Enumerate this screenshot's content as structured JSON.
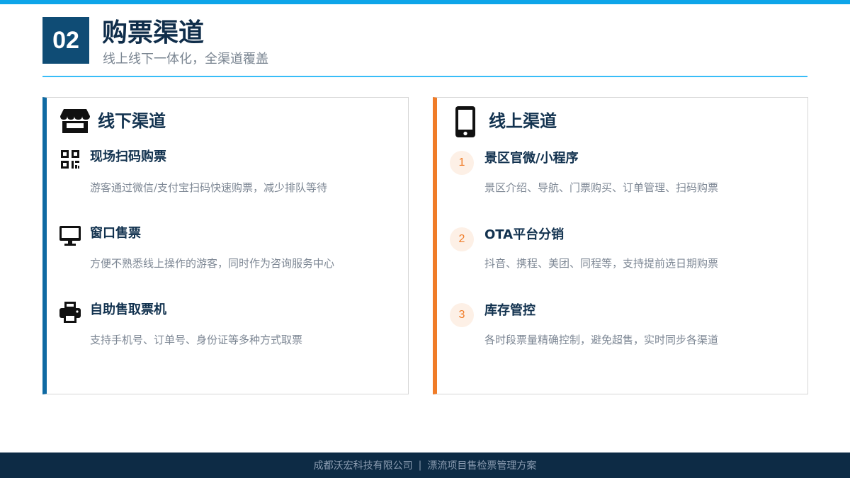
{
  "header": {
    "section_number": "02",
    "title": "购票渠道",
    "subtitle": "线上线下一体化，全渠道覆盖"
  },
  "offline": {
    "title": "线下渠道",
    "icon": "store-icon",
    "items": [
      {
        "icon": "qr-code-icon",
        "title": "现场扫码购票",
        "desc": "游客通过微信/支付宝扫码快速购票，减少排队等待"
      },
      {
        "icon": "monitor-icon",
        "title": "窗口售票",
        "desc": "方便不熟悉线上操作的游客，同时作为咨询服务中心"
      },
      {
        "icon": "printer-icon",
        "title": "自助售取票机",
        "desc": "支持手机号、订单号、身份证等多种方式取票"
      }
    ]
  },
  "online": {
    "title": "线上渠道",
    "icon": "mobile-phone-icon",
    "items": [
      {
        "number": "1",
        "title": "景区官微/小程序",
        "desc": "景区介绍、导航、门票购买、订单管理、扫码购票"
      },
      {
        "number": "2",
        "title": "OTA平台分销",
        "desc": "抖音、携程、美团、同程等，支持提前选日期购票"
      },
      {
        "number": "3",
        "title": "库存管控",
        "desc": "各时段票量精确控制，避免超售，实时同步各渠道"
      }
    ]
  },
  "footer": {
    "company": "成都沃宏科技有限公司",
    "separator": "|",
    "project": "漂流项目售检票管理方案"
  },
  "colors": {
    "accent_top": "#0ea5e9",
    "navy": "#0f4c75",
    "offline_accent": "#0f6aa3",
    "online_accent": "#f07c28",
    "footer_bg": "#0d2b45"
  }
}
